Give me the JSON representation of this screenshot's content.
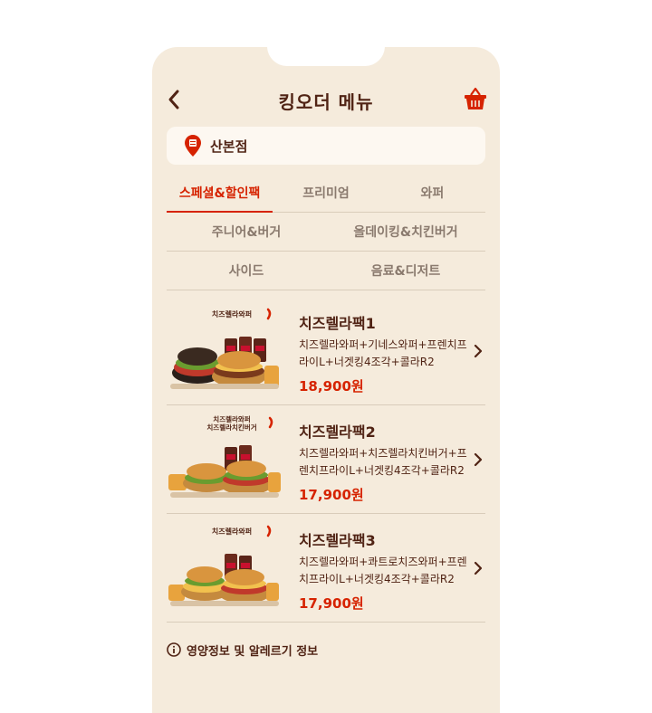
{
  "header": {
    "title": "킹오더 메뉴"
  },
  "store": {
    "name": "산본점"
  },
  "tabs": [
    [
      {
        "label": "스페셜&할인팩",
        "active": true
      },
      {
        "label": "프리미엄",
        "active": false
      },
      {
        "label": "와퍼",
        "active": false
      }
    ],
    [
      {
        "label": "주니어&버거",
        "active": false
      },
      {
        "label": "올데이킹&치킨버거",
        "active": false
      }
    ],
    [
      {
        "label": "사이드",
        "active": false
      },
      {
        "label": "음료&디저트",
        "active": false
      }
    ]
  ],
  "items": [
    {
      "badge": [
        "치즈렐라와퍼"
      ],
      "name": "치즈렐라팩1",
      "desc": "치즈렐라와퍼+기네스와퍼+프렌치프라이L+너겟킹4조각+콜라R2",
      "price": "18,900원"
    },
    {
      "badge": [
        "치즈렐라와퍼",
        "치즈렐라치킨버거"
      ],
      "name": "치즈렐라팩2",
      "desc": "치즈렐라와퍼+치즈렐라치킨버거+프렌치프라이L+너겟킹4조각+콜라R2",
      "price": "17,900원"
    },
    {
      "badge": [
        "치즈렐라와퍼"
      ],
      "name": "치즈렐라팩3",
      "desc": "치즈렐라와퍼+콰트로치즈와퍼+프렌치프라이L+너겟킹4조각+콜라R2",
      "price": "17,900원"
    }
  ],
  "footer": {
    "nutrition_label": "영양정보 및 알레르기 정보"
  },
  "colors": {
    "accent": "#d62300",
    "text": "#502314",
    "background": "#f5ebdc"
  }
}
